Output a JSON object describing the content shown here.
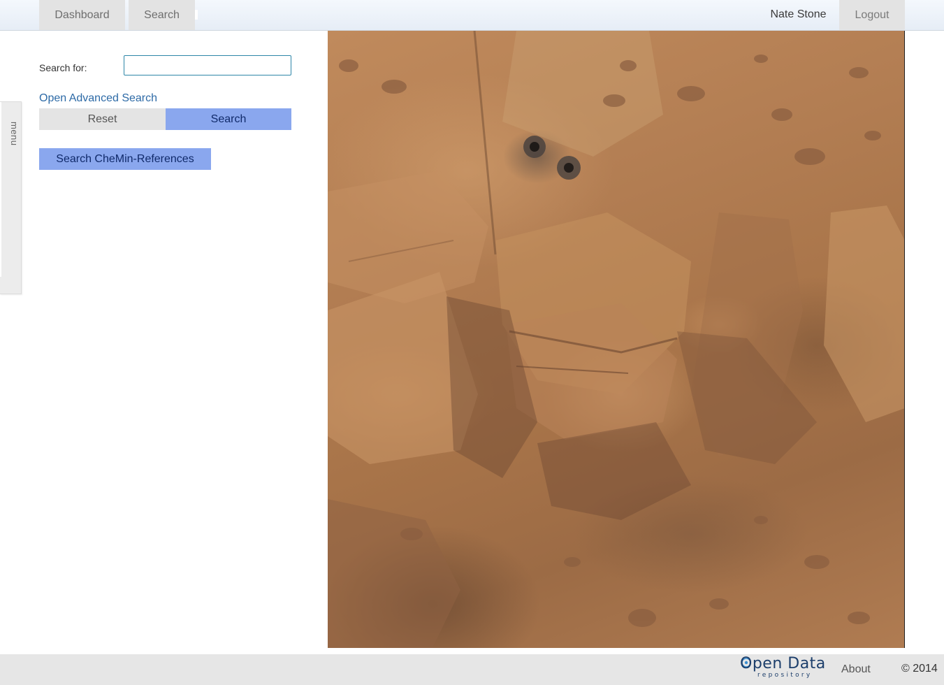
{
  "nav": {
    "tabs": [
      {
        "label": "Dashboard"
      },
      {
        "label": "Search"
      }
    ],
    "user_name": "Nate Stone",
    "logout_label": "Logout"
  },
  "side_menu": {
    "label": "menu"
  },
  "search_form": {
    "label": "Search for:",
    "input_value": "",
    "input_placeholder": "",
    "advanced_link": "Open Advanced Search",
    "reset_label": "Reset",
    "search_label": "Search",
    "chemin_label": "Search CheMin-References"
  },
  "image": {
    "alt": "Mars rock surface"
  },
  "footer": {
    "logo_main": "Open Data",
    "logo_sub": "repository",
    "about_label": "About",
    "copyright": "© 2014"
  },
  "colors": {
    "accent_button": "#8aa7ee",
    "link": "#2d6aa6",
    "tab_bg": "#e3e3e3",
    "footer_bg": "#e6e6e6"
  }
}
